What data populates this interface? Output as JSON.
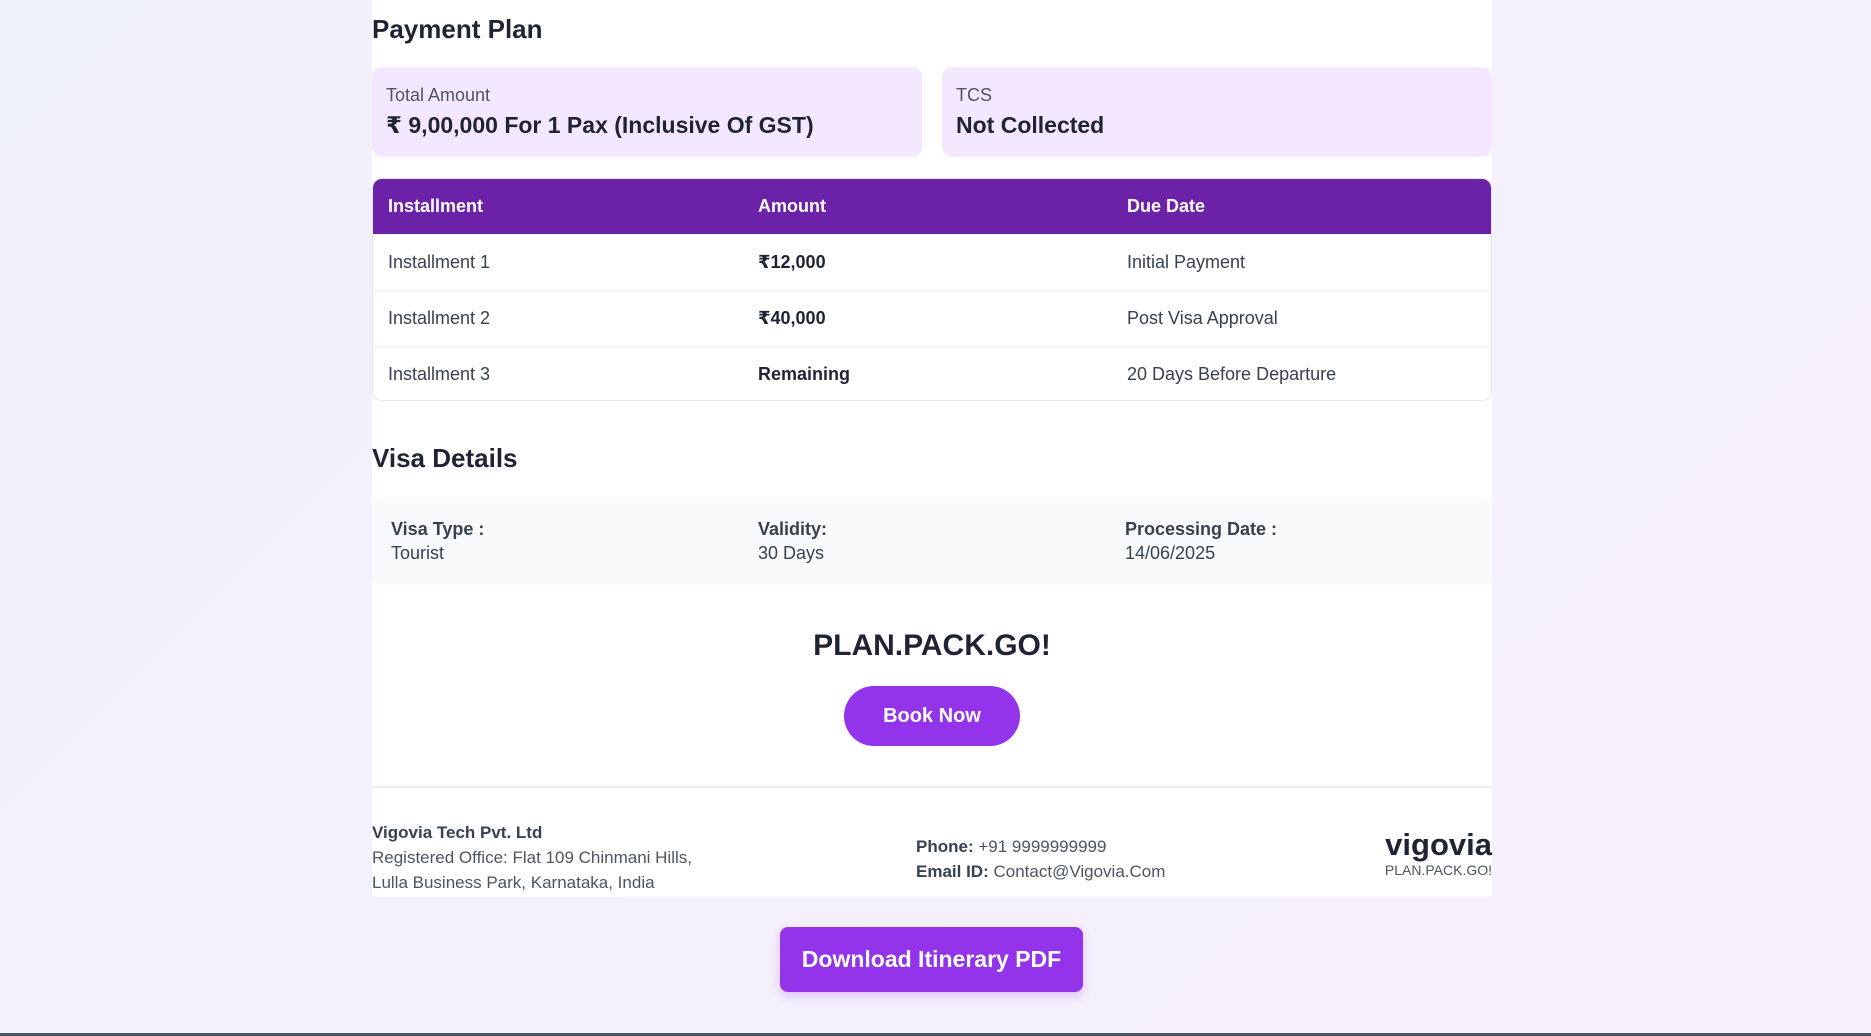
{
  "payment_plan": {
    "title": "Payment Plan",
    "total_amount_label": "Total Amount",
    "total_amount_value": "₹ 9,00,000 For 1 Pax (Inclusive Of GST)",
    "tcs_label": "TCS",
    "tcs_value": "Not Collected",
    "columns": [
      "Installment",
      "Amount",
      "Due Date"
    ],
    "rows": [
      {
        "installment": "Installment 1",
        "amount": "₹12,000",
        "due": "Initial Payment"
      },
      {
        "installment": "Installment 2",
        "amount": "₹40,000",
        "due": "Post Visa Approval"
      },
      {
        "installment": "Installment 3",
        "amount": "Remaining",
        "due": "20 Days Before Departure"
      }
    ]
  },
  "visa": {
    "title": "Visa Details",
    "type_label": "Visa Type :",
    "type_value": "Tourist",
    "validity_label": "Validity:",
    "validity_value": "30 Days",
    "processing_label": "Processing Date :",
    "processing_value": "14/06/2025"
  },
  "cta": {
    "tagline": "PLAN.PACK.GO!",
    "book_label": "Book Now"
  },
  "footer": {
    "company_name": "Vigovia Tech Pvt. Ltd",
    "address_line1": "Registered Office: Flat 109 Chinmani Hills,",
    "address_line2": "Lulla Business Park, Karnataka, India",
    "phone_label": "Phone:",
    "phone_value": "+91 9999999999",
    "email_label": "Email ID:",
    "email_value": "Contact@Vigovia.Com",
    "brand_logo": "vigovia",
    "brand_tagline": "PLAN.PACK.GO!"
  },
  "download_label": "Download Itinerary PDF",
  "colors": {
    "accent": "#9333ea",
    "table_header": "#6b21a8",
    "card_bg": "#f3e8fd"
  }
}
